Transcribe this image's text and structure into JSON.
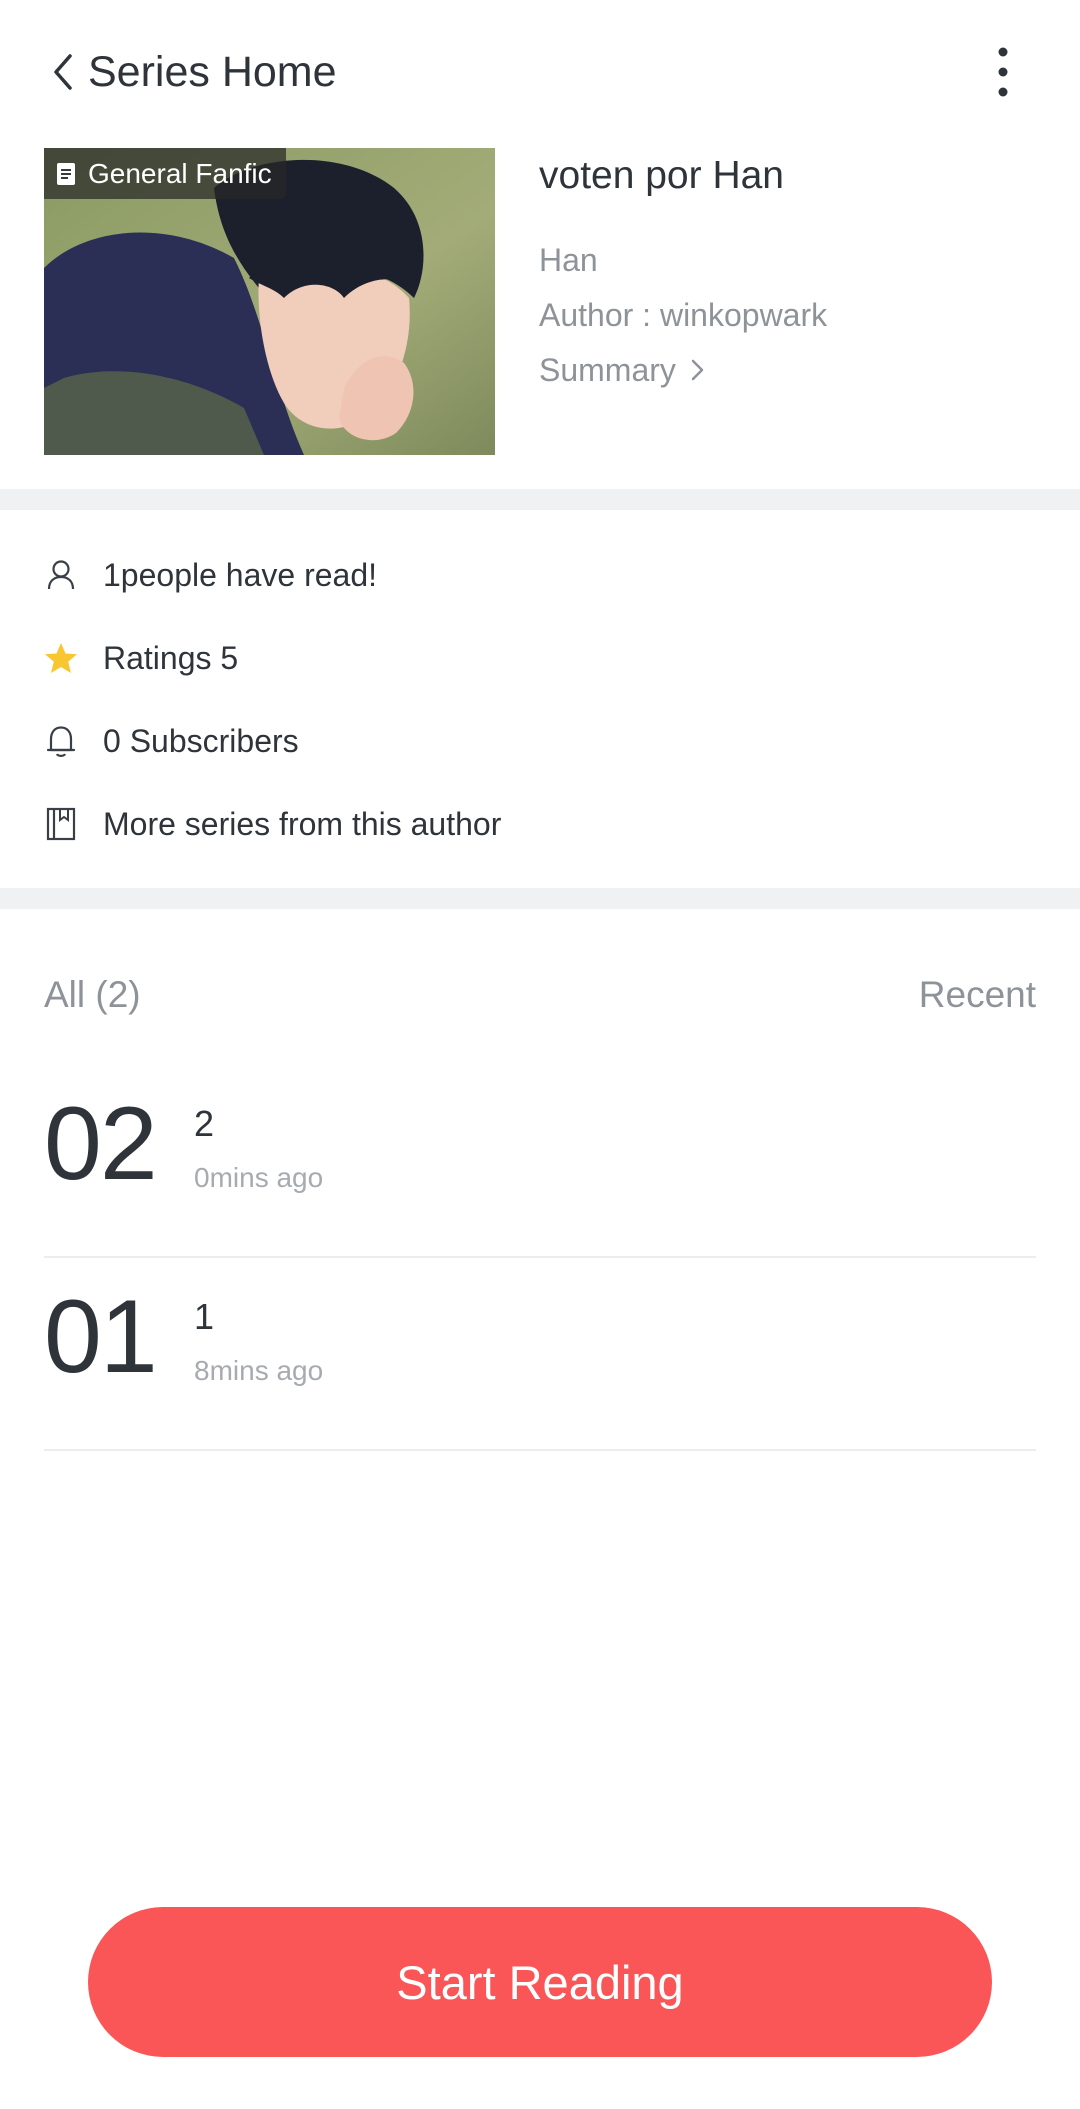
{
  "header": {
    "title": "Series Home"
  },
  "cover": {
    "tag": "General Fanfic",
    "alt": "Series cover photo"
  },
  "series": {
    "title": "voten por Han",
    "genre": "Han",
    "author": "Author : winkopwark",
    "summary_label": "Summary"
  },
  "stats": {
    "readers": "1people have read!",
    "ratings": "Ratings 5",
    "subscribers": "0 Subscribers",
    "more_series": "More series from this author"
  },
  "episodes_header": {
    "all": "All (2)",
    "sort": "Recent"
  },
  "episodes": [
    {
      "num": "02",
      "title": "2",
      "time": "0mins ago"
    },
    {
      "num": "01",
      "title": "1",
      "time": "8mins ago"
    }
  ],
  "actions": {
    "start": "Start Reading"
  },
  "colors": {
    "accent": "#fa5657",
    "star": "#f8c630",
    "band": "#f0f1f3",
    "muted": "#8e9399"
  }
}
